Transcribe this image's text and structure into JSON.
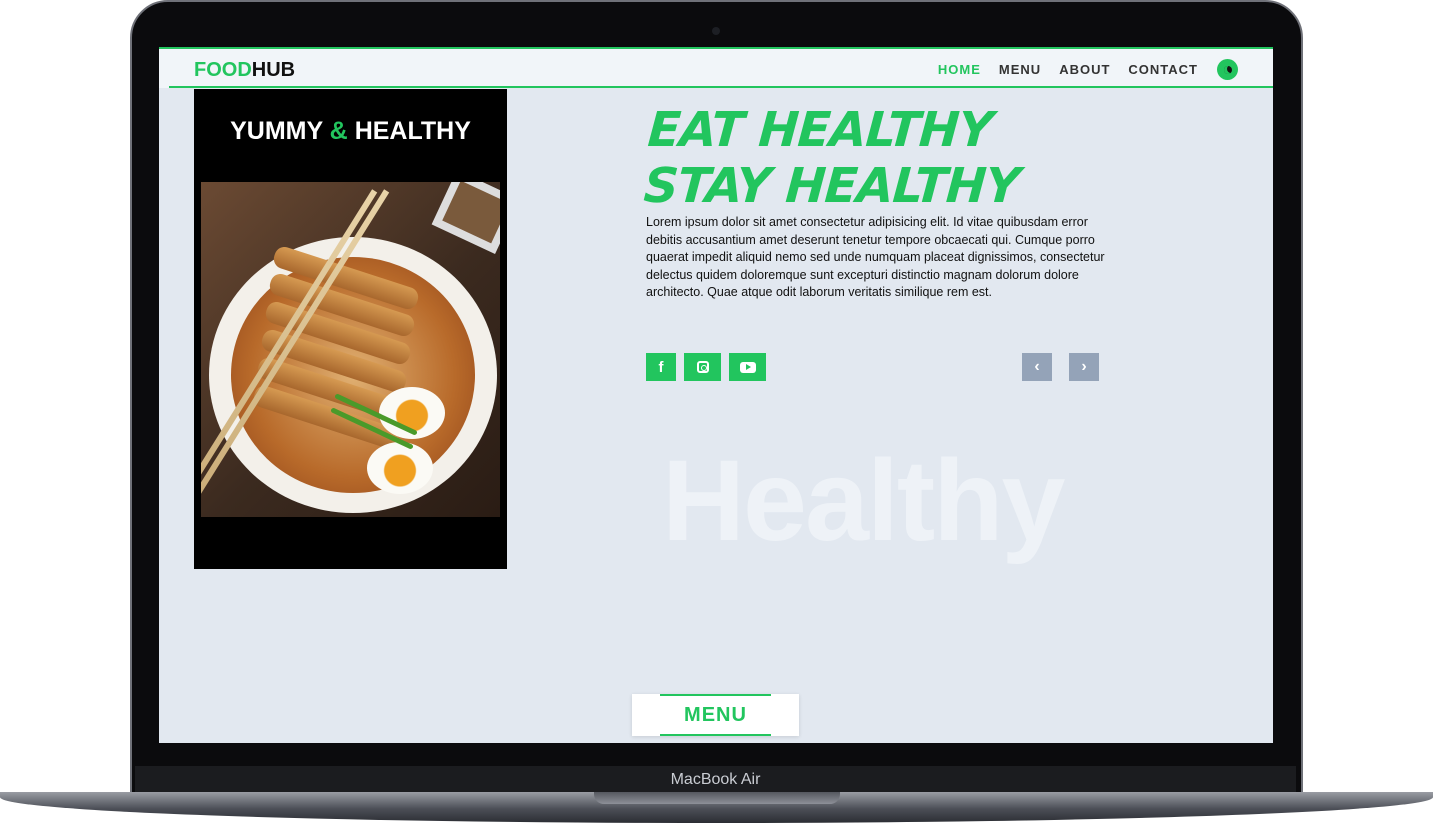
{
  "device": {
    "label": "MacBook Air"
  },
  "brand": {
    "part1": "FOOD",
    "part2": "HUB",
    "accent": "#22c55e"
  },
  "nav": {
    "items": [
      {
        "label": "HOME",
        "active": true
      },
      {
        "label": "MENU",
        "active": false
      },
      {
        "label": "ABOUT",
        "active": false
      },
      {
        "label": "CONTACT",
        "active": false
      }
    ],
    "theme_toggle_icon": "moon-icon"
  },
  "card": {
    "title_part1": "YUMMY",
    "title_amp": "&",
    "title_part2": "HEALTHY",
    "image": "ramen-bowl-with-chicken-katsu-and-eggs"
  },
  "hero": {
    "headline_line1": "EAT HEALTHY",
    "headline_line2": "STAY HEALTHY",
    "description": "Lorem ipsum dolor sit amet consectetur adipisicing elit. Id vitae quibusdam error debitis accusantium amet deserunt tenetur tempore obcaecati qui. Cumque porro quaerat impedit aliquid nemo sed unde numquam placeat dignissimos, consectetur delectus quidem doloremque sunt excepturi distinctio magnam dolorum dolore architecto. Quae atque odit laborum veritatis similique rem est.",
    "social": [
      "facebook-icon",
      "instagram-icon",
      "youtube-icon"
    ],
    "facebook_glyph": "f",
    "prev_glyph": "‹",
    "next_glyph": "›",
    "watermark": "Healthy"
  },
  "menu_button": {
    "label": "MENU"
  },
  "colors": {
    "background": "#e2e8f0",
    "navbar": "#f1f5f9",
    "slider_button": "#94a3b8"
  }
}
